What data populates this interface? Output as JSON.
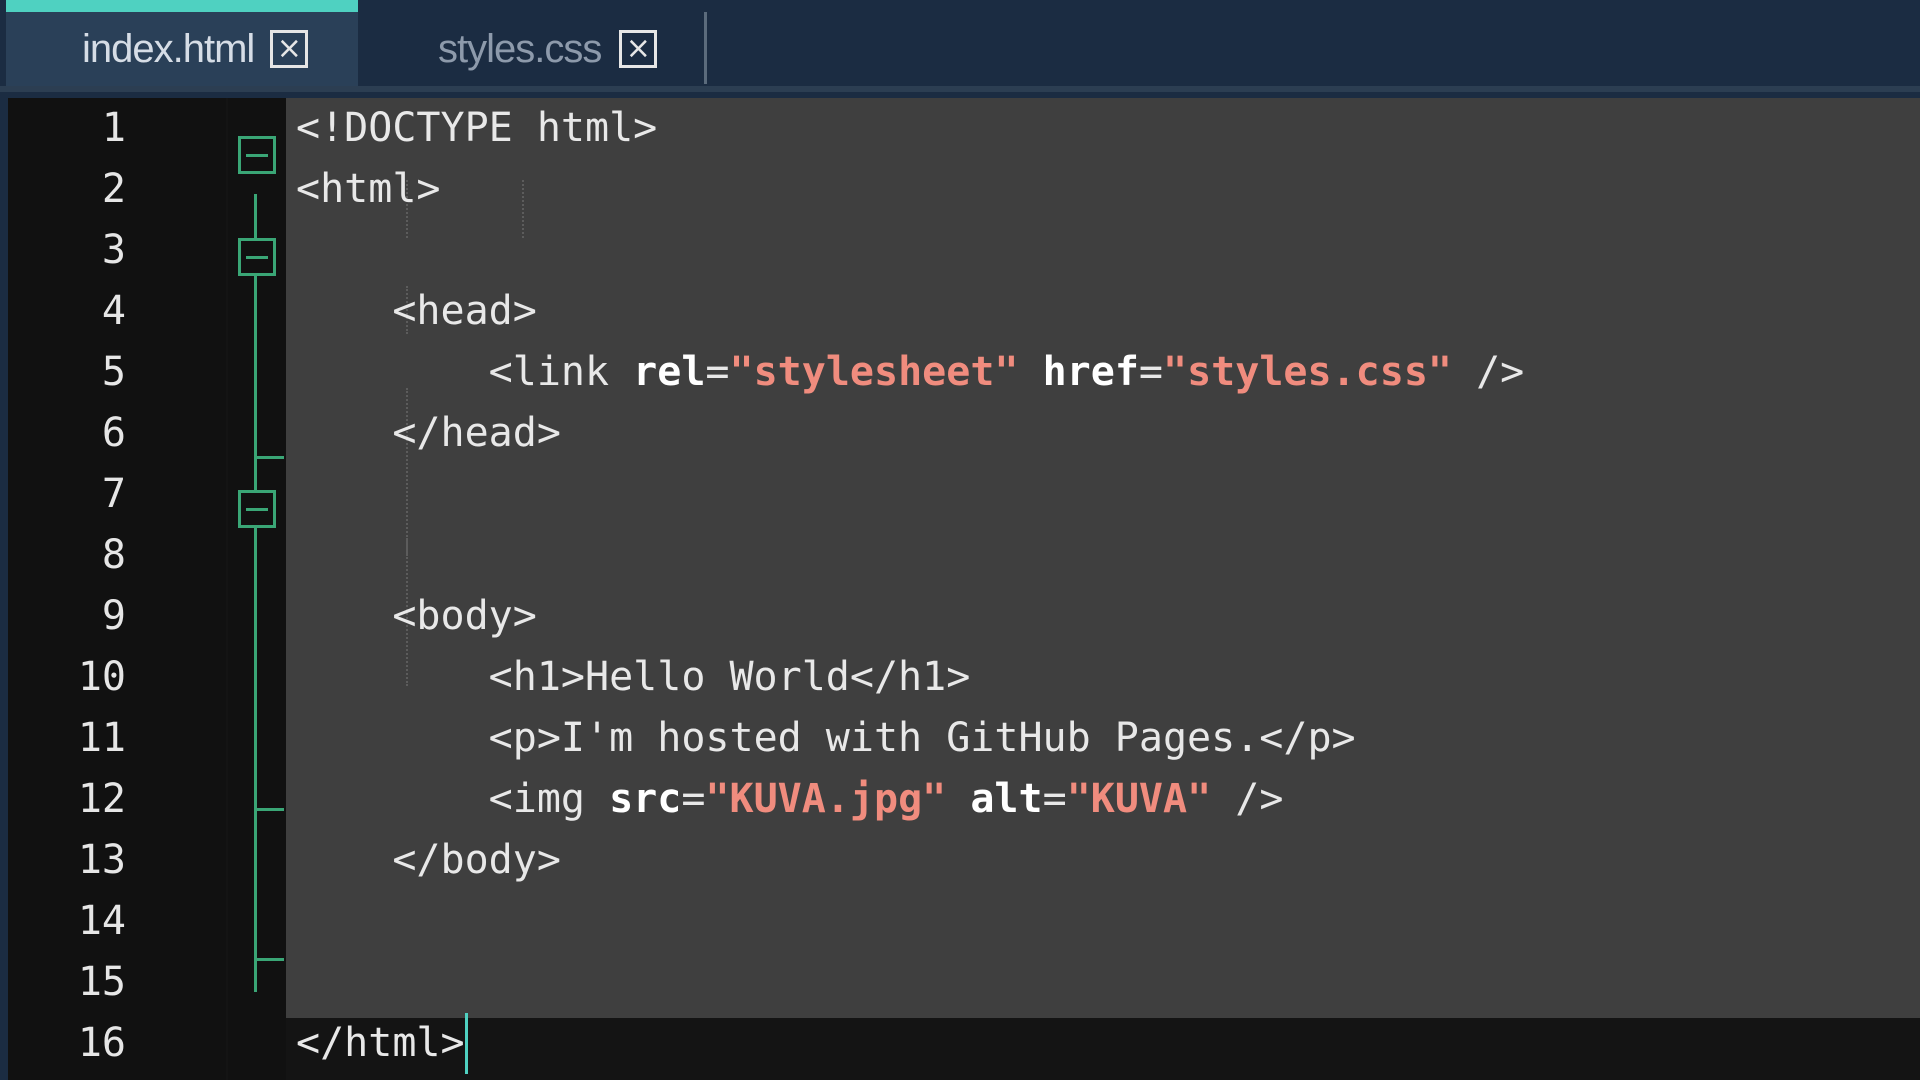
{
  "tabs": [
    {
      "label": "index.html",
      "active": true,
      "close_icon": "close-box-icon"
    },
    {
      "label": "styles.css",
      "active": false,
      "close_icon": "close-box-icon"
    }
  ],
  "colors": {
    "active_tab_accent": "#4fd1c1",
    "fold_marker": "#3aa676",
    "string": "#f08c7e",
    "attribute": "#ffffff",
    "code_background": "#3f3f3f",
    "gutter_background": "#111111"
  },
  "editor": {
    "line_numbers": [
      "1",
      "2",
      "3",
      "4",
      "5",
      "6",
      "7",
      "8",
      "9",
      "10",
      "11",
      "12",
      "13",
      "14",
      "15",
      "16"
    ],
    "lines": [
      [
        {
          "t": "tag",
          "v": "<!DOCTYPE html>"
        }
      ],
      [
        {
          "t": "tag",
          "v": "<html>"
        }
      ],
      [],
      [
        {
          "t": "tag",
          "v": "    <head>"
        }
      ],
      [
        {
          "t": "tag",
          "v": "        <link "
        },
        {
          "t": "attr",
          "v": "rel"
        },
        {
          "t": "tag",
          "v": "="
        },
        {
          "t": "str",
          "v": "\"stylesheet\""
        },
        {
          "t": "tag",
          "v": " "
        },
        {
          "t": "attr",
          "v": "href"
        },
        {
          "t": "tag",
          "v": "="
        },
        {
          "t": "str",
          "v": "\"styles.css\""
        },
        {
          "t": "tag",
          "v": " />"
        }
      ],
      [
        {
          "t": "tag",
          "v": "    </head>"
        }
      ],
      [],
      [],
      [
        {
          "t": "tag",
          "v": "    <body>"
        }
      ],
      [
        {
          "t": "tag",
          "v": "        <h1>"
        },
        {
          "t": "text",
          "v": "Hello World"
        },
        {
          "t": "tag",
          "v": "</h1>"
        }
      ],
      [
        {
          "t": "tag",
          "v": "        <p>"
        },
        {
          "t": "text",
          "v": "I'm hosted with GitHub Pages."
        },
        {
          "t": "tag",
          "v": "</p>"
        }
      ],
      [
        {
          "t": "tag",
          "v": "        <img "
        },
        {
          "t": "attr",
          "v": "src"
        },
        {
          "t": "tag",
          "v": "="
        },
        {
          "t": "str",
          "v": "\"KUVA.jpg\""
        },
        {
          "t": "tag",
          "v": " "
        },
        {
          "t": "attr",
          "v": "alt"
        },
        {
          "t": "tag",
          "v": "="
        },
        {
          "t": "str",
          "v": "\"KUVA\""
        },
        {
          "t": "tag",
          "v": " />"
        }
      ],
      [
        {
          "t": "tag",
          "v": "    </body>"
        }
      ],
      [],
      [],
      [
        {
          "t": "tag",
          "v": "</html>"
        }
      ]
    ],
    "fold_lines": [
      "2",
      "4",
      "9"
    ],
    "cursor_line": "16"
  }
}
